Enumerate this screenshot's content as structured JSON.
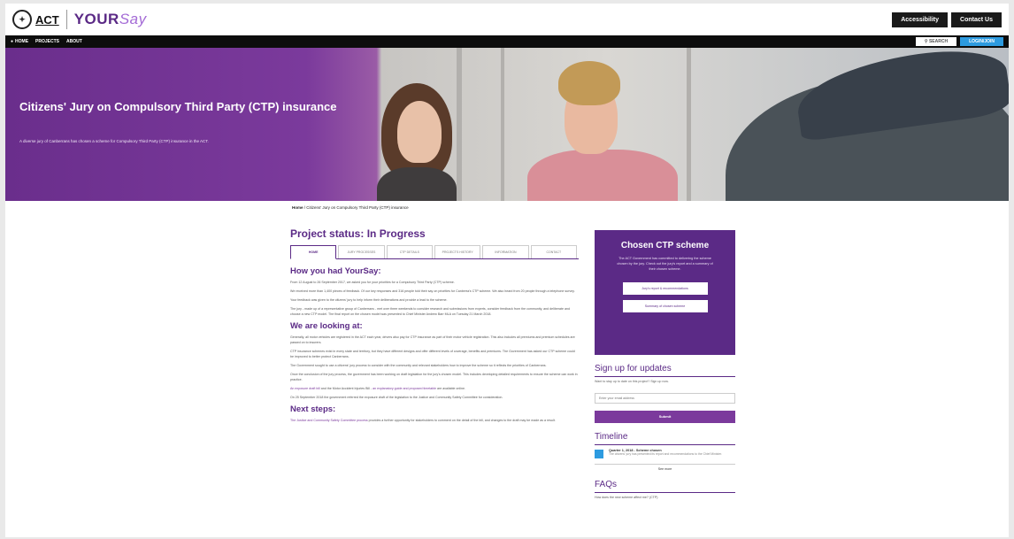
{
  "header": {
    "act_label": "ACT",
    "brand_your": "YOUR",
    "brand_say": "Say",
    "accessibility": "Accessibility",
    "contact": "Contact Us"
  },
  "nav": {
    "items": [
      "HOME",
      "PROJECTS",
      "ABOUT"
    ],
    "search": "SEARCH",
    "login": "LOGIN/JOIN"
  },
  "hero": {
    "title": "Citizens' Jury on Compulsory Third Party (CTP) insurance",
    "subtitle": "A diverse jury of Canberrans has chosen a scheme for Compulsory Third Party (CTP) insurance in the ACT."
  },
  "breadcrumb": {
    "home": "Home",
    "current": "/ Citizens' Jury on Compulsory Third Party (CTP) insurance"
  },
  "main": {
    "status_title": "Project status: In Progress",
    "tabs": [
      "HOME",
      "JURY PROCESSES",
      "CTP DETAILS",
      "PROJECTS HISTORY",
      "INFORMATION",
      "CONTACT"
    ],
    "section1_title": "How you had YourSay:",
    "section1_paras": [
      "From 12 August to 26 September 2017, we asked you for your priorities for a Compulsory Third Party (CTP) scheme.",
      "We received more than 1,400 pieces of feedback. Of our key responses and 316 people told their say on priorities for Canberra's CTP scheme. We also heard from 20 people through a telephone survey.",
      "Your feedback was given to the citizens' jury to help inform their deliberations and provide a lead to the scheme.",
      "The jury - made up of a representative group of Canberrans - met over three weekends to consider research and submissions from experts, consider feedback from the community, and deliberate and choose a new CTP model. The final report on the chosen model was presented to Chief Minister Andrew Barr MLA on Tuesday 21 March 2018."
    ],
    "section2_title": "We are looking at:",
    "section2_paras": [
      "Generally, all motor vehicles are registered in the ACT each year, drivers also pay for CTP insurance as part of their motor vehicle registration. This also includes all premiums and premium schedules are passed on to insurers.",
      "CTP insurance schemes exist in every state and territory, but they have different designs and offer different levels of coverage, benefits and premiums. The Government has asked our CTP scheme could be improved to better protect Canberrans.",
      "The Government sought to use a citizens' jury process to consider with the community and relevant stakeholders how to improve the scheme so it reflects the priorities of Canberrans.",
      "Once the conclusion of the jury process, the government has been working on draft legislation for the jury's chosen model. This includes developing detailed requirements to ensure the scheme can work in practice.",
      "On 25 September 2018 the government referred the exposure draft of the legislation to the Justice and Community Safety Committee for consideration."
    ],
    "link_para_a": "An exposure draft bill",
    "link_para_b": " and the Motor Accident Injuries Bill - ",
    "link_para_c": "an explanatory guide and proposed timetable",
    "link_para_d": " are available online.",
    "section3_title": "Next steps:",
    "section3_link": "The Justice and Community Safety Committee process",
    "section3_rest": " provides a further opportunity for stakeholders to comment on the detail of the bill, and changes to the draft may be made as a result."
  },
  "sidebar": {
    "chosen_title": "Chosen CTP scheme",
    "chosen_text": "The ACT Government has committed to delivering the scheme chosen by the jury. Check out the jury's report and a summary of their chosen scheme.",
    "btn_report": "Jury's report & recommendations",
    "btn_summary": "Summary of chosen scheme",
    "signup_title": "Sign up for updates",
    "signup_text": "Want to stay up to date on this project? Sign up now.",
    "email_placeholder": "Enter your email address",
    "submit": "Submit",
    "timeline_title": "Timeline",
    "timeline_date": "Quarter 1, 2018 - Scheme chosen",
    "timeline_desc": "The citizens' jury has presented its report and recommendations to the Chief Minister.",
    "see_more": "See more",
    "faq_title": "FAQs",
    "faq_text": "How does the new scheme affect me? (CTP)"
  },
  "colors": {
    "brand_purple": "#5b2a86",
    "accent_blue": "#2d9be0"
  }
}
